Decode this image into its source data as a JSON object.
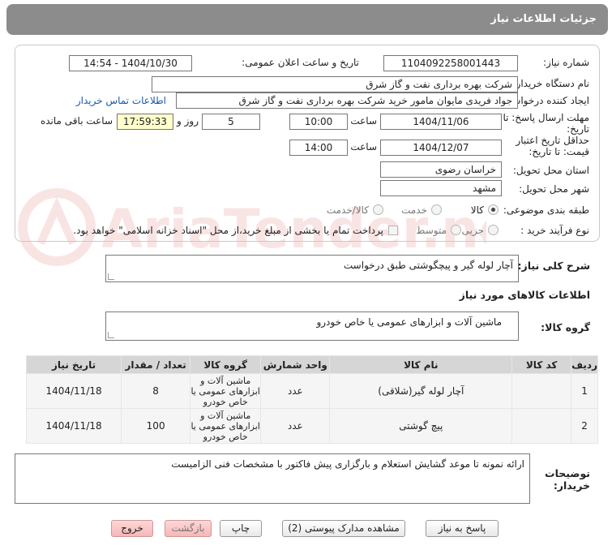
{
  "header": {
    "title": "جزئیات اطلاعات نیاز"
  },
  "fields": {
    "need_number_label": "شماره نیاز:",
    "need_number": "1104092258001443",
    "announce_label": "تاریخ و ساعت اعلان عمومی:",
    "announce_value": "1404/10/30 - 14:54",
    "buyer_org_label": "نام دستگاه خریدار:",
    "buyer_org": "شرکت بهره برداری نفت و گاز شرق",
    "creator_label": "ایجاد کننده درخواست:",
    "creator": "جواد فریدی مایوان مامور خرید شرکت بهره برداری نفت و گاز شرق",
    "contact_link": "اطلاعات تماس خریدار",
    "deadline_label_1": "مهلت ارسال پاسخ: تا",
    "deadline_label_2": "تاریخ:",
    "deadline_date": "1404/11/06",
    "time_word": "ساعت",
    "deadline_time": "10:00",
    "days_value": "5",
    "days_word": "روز و",
    "remaining_time": "17:59:33",
    "remaining_label": "ساعت باقی مانده",
    "validity_label_1": "حداقل تاریخ اعتبار",
    "validity_label_2": "قیمت: تا تاریخ:",
    "validity_date": "1404/12/07",
    "validity_time": "14:00",
    "province_label": "استان محل تحویل:",
    "province": "خراسان رضوی",
    "city_label": "شهر محل تحویل:",
    "city": "مشهد",
    "category_label": "طبقه بندی موضوعی:",
    "category_options": [
      "کالا",
      "خدمت",
      "کالا/خدمت"
    ],
    "process_label": "نوع فرآیند خرید :",
    "process_options": [
      "جزیی",
      "متوسط"
    ],
    "payment_note": "پرداخت تمام یا بخشی از مبلغ خرید،از محل \"اسناد خزانه اسلامی\" خواهد بود."
  },
  "summary": {
    "label": "شرح کلی نیاز:",
    "value": "آچار لوله گیر و پیچگوشتی طبق درخواست"
  },
  "goods": {
    "section_title": "اطلاعات کالاهای مورد نیاز",
    "group_label": "گروه کالا:",
    "group_value": "ماشین آلات و ابزارهای عمومی یا خاص خودرو"
  },
  "table": {
    "headers": [
      "ردیف",
      "کد کالا",
      "نام کالا",
      "واحد شمارش",
      "گروه کالا",
      "تعداد / مقدار",
      "تاریخ نیاز"
    ],
    "rows": [
      {
        "row": "1",
        "code": "",
        "name": "آچار لوله گیر(شلاقی)",
        "unit": "عدد",
        "group": "ماشین آلات و ابزارهای عمومی یا خاص خودرو",
        "qty": "8",
        "date": "1404/11/18"
      },
      {
        "row": "2",
        "code": "",
        "name": "پیچ گوشتی",
        "unit": "عدد",
        "group": "ماشین آلات و ابزارهای عمومی یا خاص خودرو",
        "qty": "100",
        "date": "1404/11/18"
      }
    ]
  },
  "buyer_notes": {
    "label_1": "توضیحات",
    "label_2": "خریدار:",
    "value": "ارائه نمونه تا موعد گشایش استعلام  و بارگزاری پیش فاکتور با مشخصات فنی الزامیست"
  },
  "buttons": {
    "reply": "پاسخ به نیاز",
    "attachments": "مشاهده مدارک پیوستی (2)",
    "print": "چاپ",
    "back": "بازگشت",
    "exit": "خروج"
  },
  "watermark": {
    "text": "AriaTender.net"
  }
}
